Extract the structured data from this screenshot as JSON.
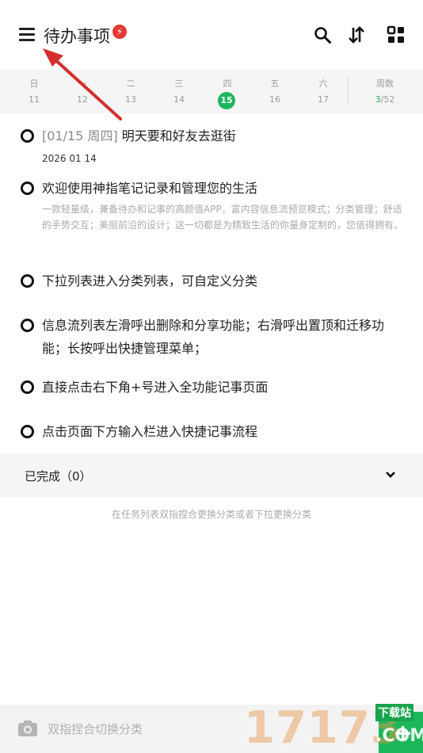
{
  "header": {
    "title": "待办事项",
    "badge": "⚡",
    "menu_icon": "hamburger-menu-icon",
    "actions": [
      "search-icon",
      "sort-icon",
      "grid-apps-icon"
    ]
  },
  "week": {
    "days": [
      {
        "name": "日",
        "num": "11"
      },
      {
        "name": "一",
        "num": "12"
      },
      {
        "name": "二",
        "num": "13"
      },
      {
        "name": "三",
        "num": "14"
      },
      {
        "name": "四",
        "num": "15"
      },
      {
        "name": "五",
        "num": "16"
      },
      {
        "name": "六",
        "num": "17"
      }
    ],
    "selected_index": 4,
    "week_label": "周数",
    "week_current": "3",
    "week_total": "/52",
    "accent": "#1db75a"
  },
  "tasks": [
    {
      "prefix": "[01/15 周四]",
      "title": "明天要和好友去逛街",
      "sub": "2026 01 14"
    },
    {
      "title": "欢迎使用神指笔记记录和管理您的生活",
      "desc": "一款轻量级，兼备待办和记事的高颜值APP，富内容信息流预览模式；分类管理；舒适的手势交互；美丽前沿的设计；这一切都是为精致生活的你量身定制的，您值得拥有。"
    },
    {
      "title": "下拉列表进入分类列表，可自定义分类"
    },
    {
      "title": "信息流列表左滑呼出删除和分享功能；右滑呼出置顶和迁移功能；长按呼出快捷管理菜单；"
    },
    {
      "title": "直接点击右下角+号进入全功能记事页面"
    },
    {
      "title": "点击页面下方输入栏进入快捷记事流程"
    }
  ],
  "completed": {
    "label": "已完成（0）"
  },
  "hint": "在任务列表双指捏合更换分类或者下拉更换分类",
  "bottom": {
    "placeholder": "双指捏合切换分类",
    "add_label": "+"
  },
  "watermark": {
    "digits": "17173",
    "tag": "下载站",
    "dom": ".COM"
  }
}
